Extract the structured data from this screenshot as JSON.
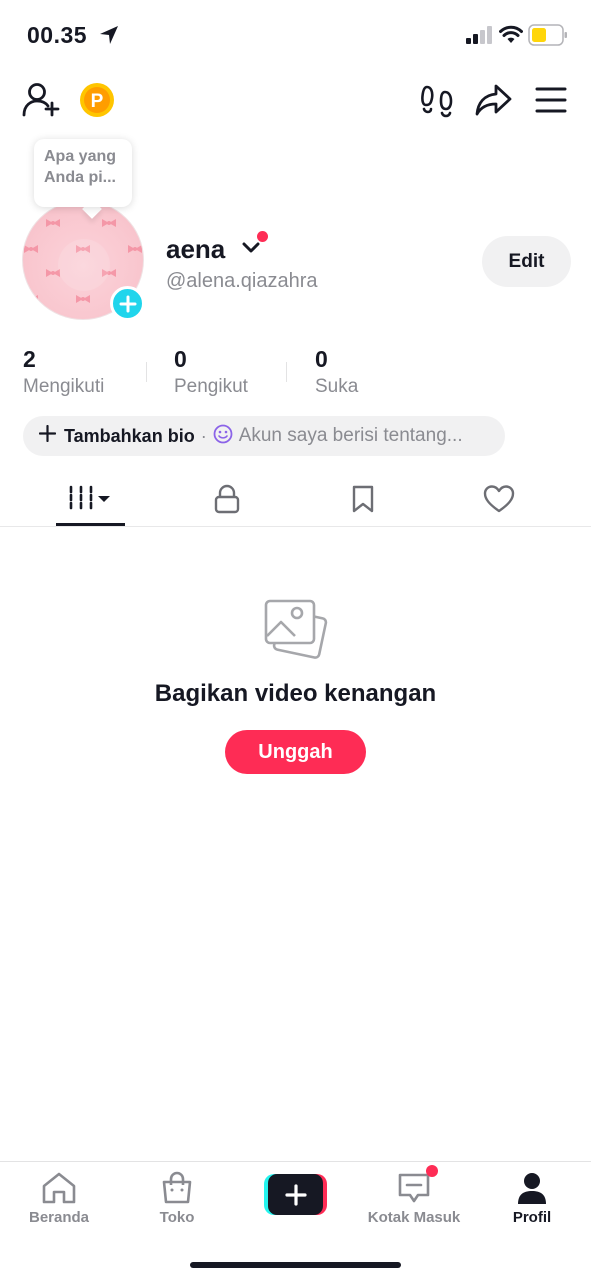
{
  "status_bar": {
    "time": "00.35"
  },
  "tooltip": {
    "line1": "Apa yang",
    "line2": "Anda pi..."
  },
  "profile": {
    "display_name": "aena",
    "username": "@alena.qiazahra",
    "edit_label": "Edit"
  },
  "stats": [
    {
      "value": "2",
      "label": "Mengikuti"
    },
    {
      "value": "0",
      "label": "Pengikut"
    },
    {
      "value": "0",
      "label": "Suka"
    }
  ],
  "bio": {
    "add_label": "Tambahkan bio",
    "separator": "·",
    "hint": "Akun saya berisi tentang..."
  },
  "empty_state": {
    "title": "Bagikan video kenangan",
    "upload_label": "Unggah"
  },
  "bottom_nav": {
    "home": "Beranda",
    "shop": "Toko",
    "inbox": "Kotak Masuk",
    "profile": "Profil"
  },
  "colors": {
    "accent": "#fe2c55",
    "cyan": "#20d5ec",
    "text": "#161823",
    "muted": "#8a8b91"
  }
}
